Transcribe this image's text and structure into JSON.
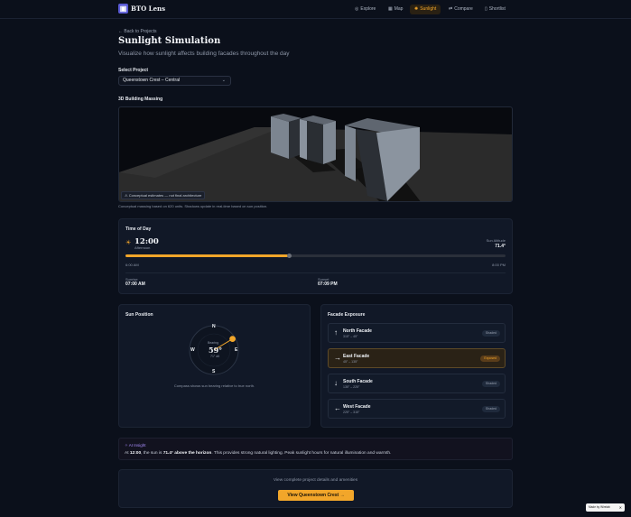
{
  "app": {
    "name": "BTO Lens",
    "logo_glyph": "▣"
  },
  "nav": [
    {
      "label": "Explore",
      "icon": "◎",
      "active": false
    },
    {
      "label": "Map",
      "icon": "▦",
      "active": false
    },
    {
      "label": "Sunlight",
      "icon": "✺",
      "active": true
    },
    {
      "label": "Compare",
      "icon": "⇄",
      "active": false
    },
    {
      "label": "Shortlist",
      "icon": "▯",
      "active": false
    }
  ],
  "page": {
    "back_link": "← Back to Projects",
    "title": "Sunlight Simulation",
    "subtitle": "Visualize how sunlight affects building facades throughout the day"
  },
  "project": {
    "label": "Select Project",
    "value": "Queenstown Crest – Central",
    "chevron": "⌄"
  },
  "massing": {
    "label": "3D Building Massing",
    "disclaimer": "⚠ Conceptual estimates — not final architecture",
    "caption": "Conceptual massing based on 620 units. Shadows update in real-time based on sun position."
  },
  "time_of_day": {
    "title": "Time of Day",
    "time": "12:00",
    "period": "Afternoon",
    "altitude_label": "Sun Altitude",
    "altitude_value": "71.4°",
    "slider_min_label": "6:00 AM",
    "slider_max_label": "8:00 PM",
    "slider_fraction": 0.43,
    "sunrise_label": "Sunrise",
    "sunrise_value": "07:00 AM",
    "sunset_label": "Sunset",
    "sunset_value": "07:09 PM",
    "sun_icon": "☀"
  },
  "sun_position": {
    "title": "Sun Position",
    "north": "N",
    "south": "S",
    "east": "E",
    "west": "W",
    "bearing_label": "Bearing",
    "bearing_value": "59°",
    "altitude_small": "71° alt",
    "bearing_degrees": 59,
    "note": "Compass shows sun bearing relative to true north."
  },
  "facade_exposure": {
    "title": "Facade Exposure",
    "items": [
      {
        "name": "North Facade",
        "range": "315° – 45°",
        "status": "Shaded",
        "arrow": "↑"
      },
      {
        "name": "East Facade",
        "range": "45° – 135°",
        "status": "Exposed",
        "arrow": "→"
      },
      {
        "name": "South Facade",
        "range": "135° – 225°",
        "status": "Shaded",
        "arrow": "↓"
      },
      {
        "name": "West Facade",
        "range": "225° – 315°",
        "status": "Shaded",
        "arrow": "←"
      }
    ]
  },
  "insight": {
    "heading": "✧ AI Insight",
    "prefix": "At ",
    "time": "12:00",
    "middle": ", the sun is ",
    "emphasis": "71.4° above the horizon",
    "suffix": ". This provides strong natural lighting. Peak sunlight hours for natural illumination and warmth."
  },
  "cta": {
    "text": "View complete project details and amenities",
    "button": "View Queenstown Crest  →"
  },
  "made_by": {
    "label": "Made by Wirelab",
    "close": "✕"
  },
  "colors": {
    "accent": "#f2a62a",
    "background": "#0b101b",
    "card": "#111827",
    "brand": "#5b5bd6",
    "ai": "#a78bfa"
  }
}
